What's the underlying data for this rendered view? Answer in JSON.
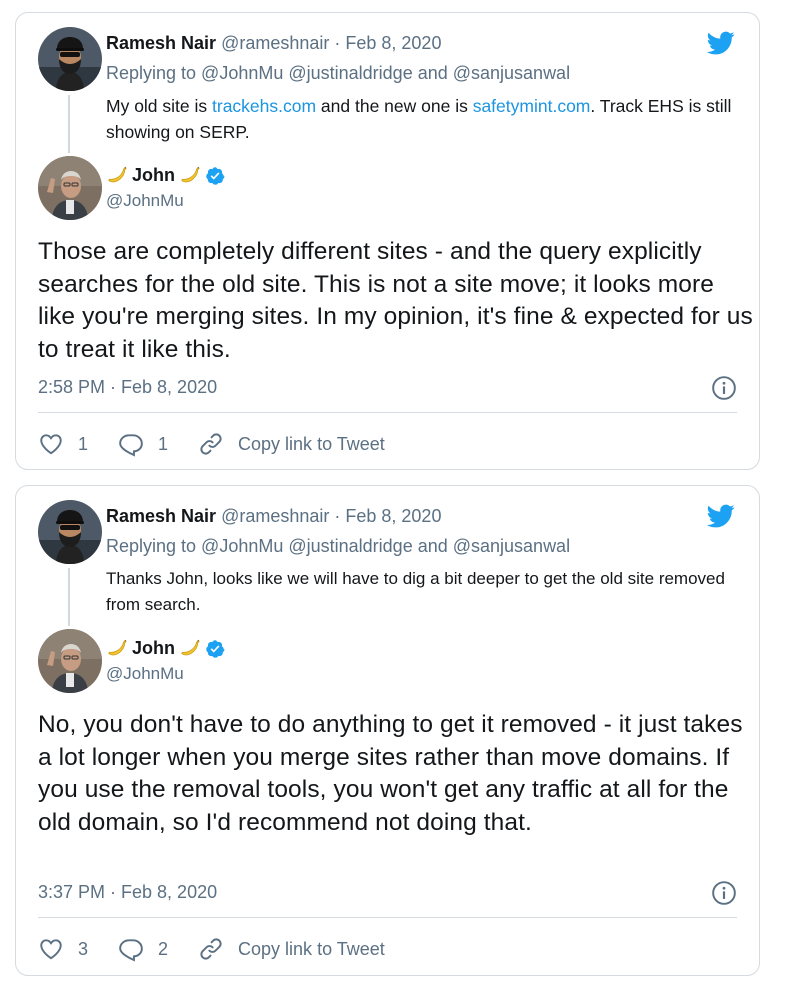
{
  "colors": {
    "link": "#1b95e0",
    "secondary_text": "#5b7083",
    "twitter_blue": "#1da1f2",
    "border": "#d5dbe0"
  },
  "icons": [
    "twitter-bird-icon",
    "banana-icon",
    "verified-badge-icon",
    "info-icon",
    "heart-icon",
    "reply-icon",
    "link-icon"
  ],
  "tweets": [
    {
      "parent": {
        "name": "Ramesh Nair",
        "meta": "@rameshnair · Feb 8, 2020",
        "replying": "Replying to @JohnMu @justinaldridge and @sanjusanwal",
        "text_before": "My old site is ",
        "link1": "trackehs.com",
        "text_middle": " and the new one is ",
        "link2": "safetymint.com",
        "text_after": ". Track EHS is still showing on SERP."
      },
      "author": {
        "name": "John",
        "handle": "@JohnMu"
      },
      "text": "Those are completely different sites - and the query explicitly searches for the old site. This is not a site move; it looks more like you're merging sites. In my opinion, it's fine & expected for us to treat it like this.",
      "timestamp": "2:58 PM · Feb 8, 2020",
      "likes": "1",
      "replies": "1",
      "copy_link": "Copy link to Tweet"
    },
    {
      "parent": {
        "name": "Ramesh Nair",
        "meta": "@rameshnair · Feb 8, 2020",
        "replying": "Replying to @JohnMu @justinaldridge and @sanjusanwal",
        "text": "Thanks John, looks like we will have to dig a bit deeper to get the old site removed from search."
      },
      "author": {
        "name": "John",
        "handle": "@JohnMu"
      },
      "text": "No, you don't have to do anything to get it removed - it just takes a lot longer when you merge sites rather than move domains. If you use the removal tools, you won't get any traffic at all for the old domain, so I'd recommend not doing that.",
      "timestamp": "3:37 PM · Feb 8, 2020",
      "likes": "3",
      "replies": "2",
      "copy_link": "Copy link to Tweet"
    }
  ]
}
